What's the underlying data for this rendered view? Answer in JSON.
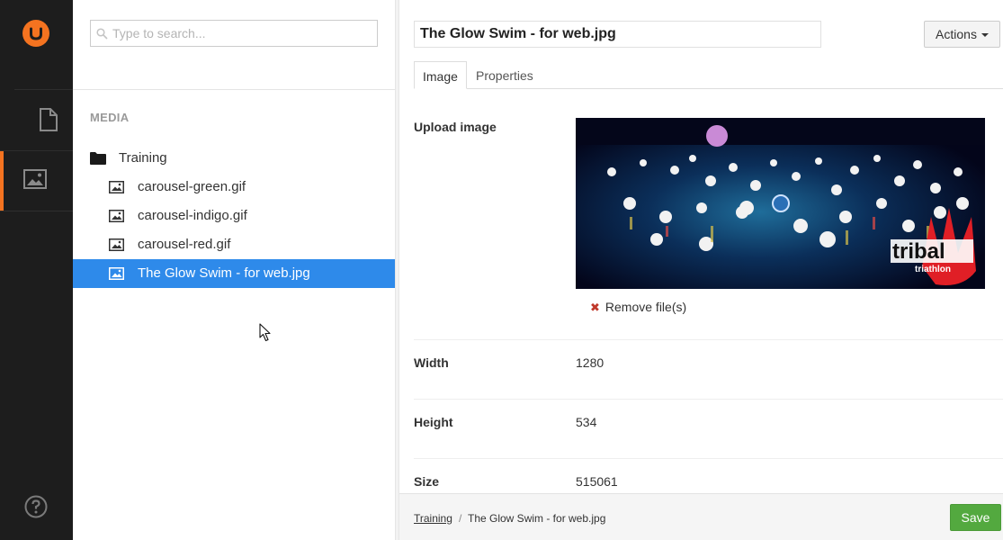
{
  "app": {
    "sections": [
      {
        "name": "content",
        "icon": "document-icon"
      },
      {
        "name": "media",
        "icon": "image-icon",
        "active": true
      }
    ],
    "help_icon": "help-icon",
    "accent": "#f47320"
  },
  "tree": {
    "search_placeholder": "Type to search...",
    "section_title": "MEDIA",
    "folder": {
      "label": "Training",
      "icon": "folder-icon"
    },
    "items": [
      {
        "label": "carousel-green.gif",
        "icon": "image-icon"
      },
      {
        "label": "carousel-indigo.gif",
        "icon": "image-icon"
      },
      {
        "label": "carousel-red.gif",
        "icon": "image-icon"
      },
      {
        "label": "The Glow Swim - for web.jpg",
        "icon": "image-icon",
        "active": true
      }
    ],
    "active_color": "#2e8aea"
  },
  "editor": {
    "name": "The Glow Swim - for web.jpg",
    "actions_label": "Actions",
    "tabs": [
      {
        "label": "Image",
        "active": true
      },
      {
        "label": "Properties",
        "active": false
      }
    ],
    "upload_label": "Upload image",
    "remove_label": "Remove file(s)",
    "image_logo_text": "tribal",
    "image_logo_sub": "triathlon",
    "fields": [
      {
        "label": "Width",
        "value": "1280"
      },
      {
        "label": "Height",
        "value": "534"
      },
      {
        "label": "Size",
        "value": "515061"
      }
    ]
  },
  "footer": {
    "breadcrumb_link": "Training",
    "breadcrumb_sep": "/",
    "breadcrumb_current": "The Glow Swim - for web.jpg",
    "save_label": "Save",
    "save_color": "#53a93f"
  }
}
